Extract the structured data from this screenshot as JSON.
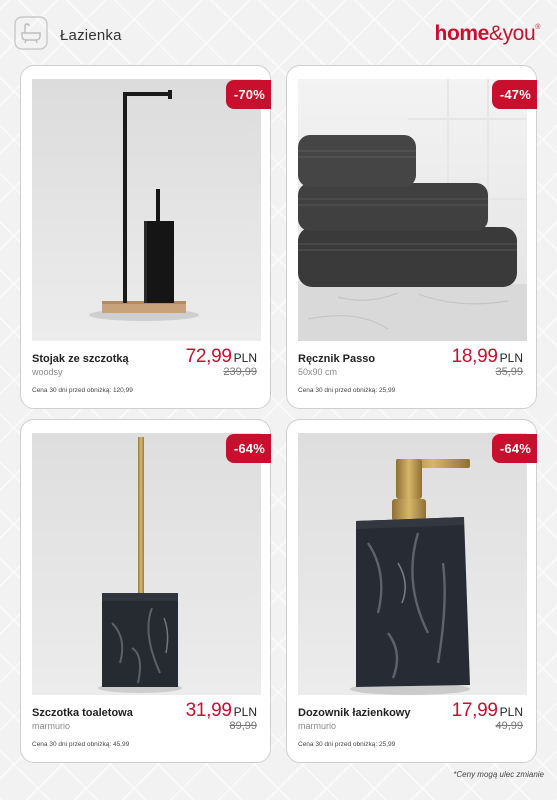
{
  "header": {
    "category_icon": "bathtub-icon",
    "title": "Łazienka",
    "brand": {
      "part1": "home",
      "part2": "&you",
      "mark": "®"
    }
  },
  "colors": {
    "accent": "#c8102e",
    "badge_text": "#ffffff"
  },
  "products": [
    {
      "name": "Stojak ze szczotką",
      "variant": "woodsy",
      "discount": "-70%",
      "price": "72,99",
      "currency": "PLN",
      "old_price": "239,99",
      "lowest_price_note": "Cena 30 dni przed obniżką: 120,99"
    },
    {
      "name": "Ręcznik Passo",
      "variant": "50x90 cm",
      "discount": "-47%",
      "price": "18,99",
      "currency": "PLN",
      "old_price": "35,99",
      "lowest_price_note": "Cena 30 dni przed obniżką: 25,99"
    },
    {
      "name": "Szczotka toaletowa",
      "variant": "marmurio",
      "discount": "-64%",
      "price": "31,99",
      "currency": "PLN",
      "old_price": "89,99",
      "lowest_price_note": "Cena 30 dni przed obniżką: 45,99"
    },
    {
      "name": "Dozownik łazienkowy",
      "variant": "marmurio",
      "discount": "-64%",
      "price": "17,99",
      "currency": "PLN",
      "old_price": "49,99",
      "lowest_price_note": "Cena 30 dni przed obniżką: 25,99"
    }
  ],
  "footer": {
    "note": "*Ceny mogą ulec zmianie"
  }
}
